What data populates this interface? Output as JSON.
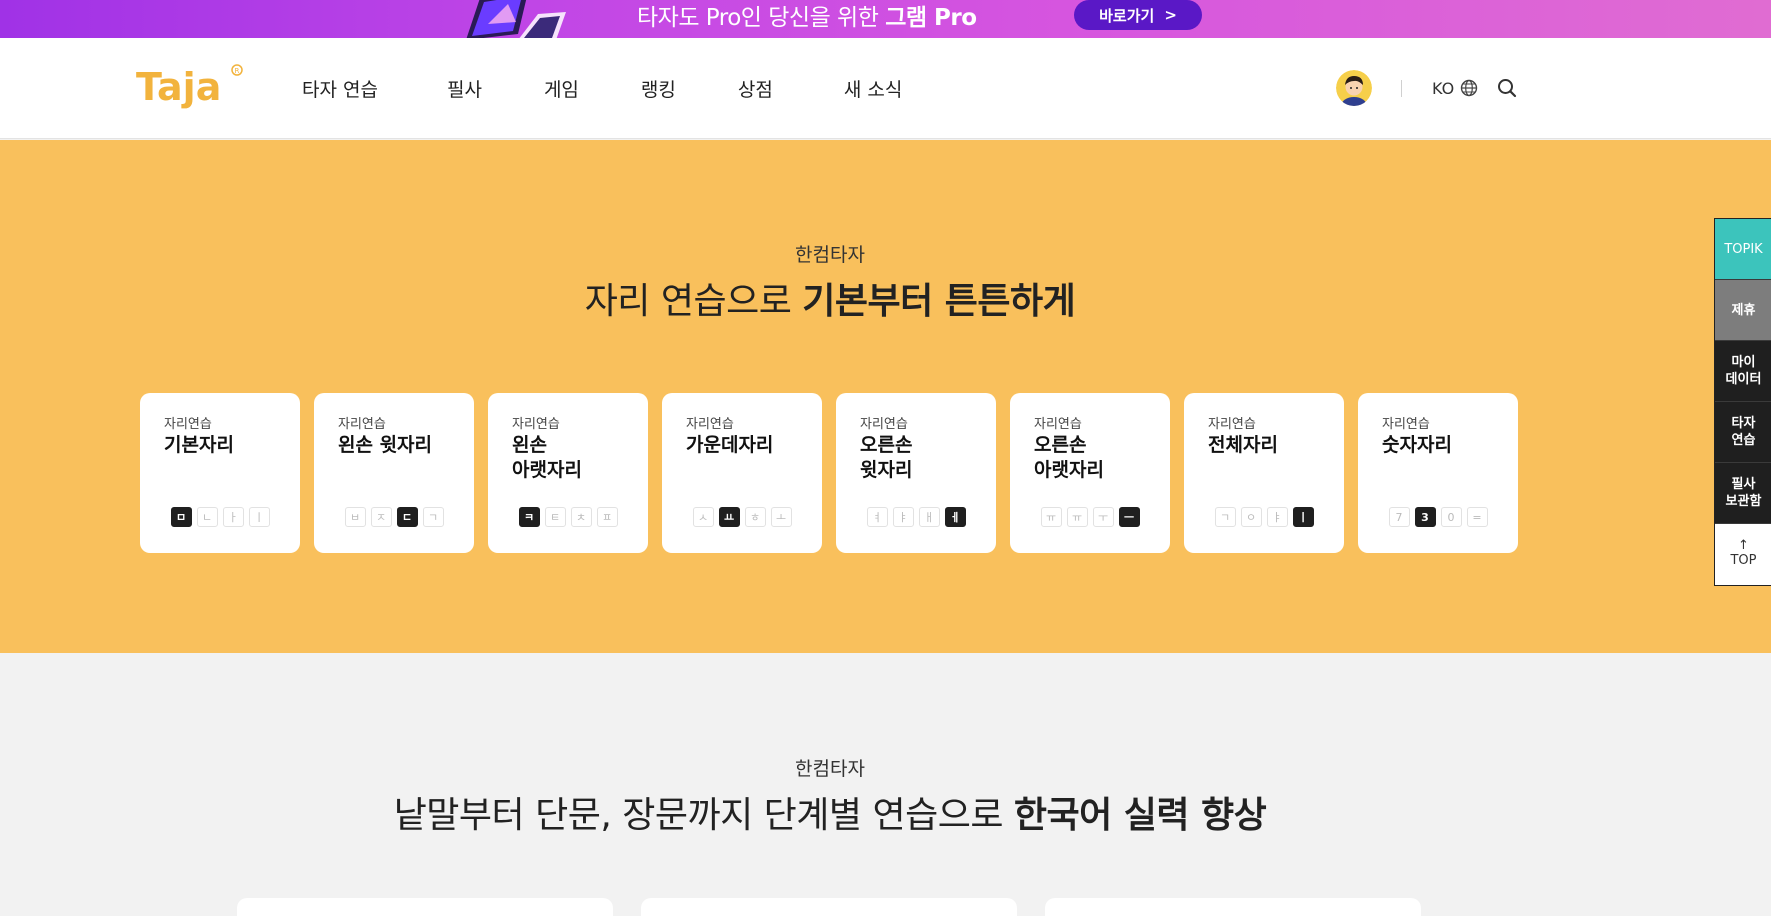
{
  "promo": {
    "text_prefix": "타자도 Pro인 당신을 위한 ",
    "text_bold": "그램 Pro",
    "button_label": "바로가기",
    "button_arrow": ">"
  },
  "header": {
    "logo_text": "Taja",
    "nav": [
      "타자 연습",
      "필사",
      "게임",
      "랭킹",
      "상점",
      "새 소식"
    ],
    "lang": "KO"
  },
  "section_position": {
    "eyebrow": "한컴타자",
    "title_regular": "자리 연습으로 ",
    "title_bold": "기본부터 튼튼하게",
    "cards": [
      {
        "eyebrow": "자리연습",
        "title": "기본자리",
        "keys": [
          "ㅁ",
          "ㄴ",
          "ㅏ",
          "ㅣ"
        ],
        "active": 0
      },
      {
        "eyebrow": "자리연습",
        "title": "왼손 윗자리",
        "keys": [
          "ㅂ",
          "ㅈ",
          "ㄷ",
          "ㄱ"
        ],
        "active": 2
      },
      {
        "eyebrow": "자리연습",
        "title": "왼손\n아랫자리",
        "keys": [
          "ㅋ",
          "ㅌ",
          "ㅊ",
          "ㅍ"
        ],
        "active": 0
      },
      {
        "eyebrow": "자리연습",
        "title": "가운데자리",
        "keys": [
          "ㅅ",
          "ㅛ",
          "ㅎ",
          "ㅗ"
        ],
        "active": 1
      },
      {
        "eyebrow": "자리연습",
        "title": "오른손\n윗자리",
        "keys": [
          "ㅕ",
          "ㅑ",
          "ㅐ",
          "ㅔ"
        ],
        "active": 3
      },
      {
        "eyebrow": "자리연습",
        "title": "오른손\n아랫자리",
        "keys": [
          "ㅠ",
          "ㅠ",
          "ㅜ",
          "ㅡ"
        ],
        "active": 3
      },
      {
        "eyebrow": "자리연습",
        "title": "전체자리",
        "keys": [
          "ㄱ",
          "ㅇ",
          "ㅑ",
          "ㅣ"
        ],
        "active": 3
      },
      {
        "eyebrow": "자리연습",
        "title": "숫자자리",
        "keys": [
          "7",
          "3",
          "0",
          "="
        ],
        "active": 1
      }
    ]
  },
  "section_korean": {
    "eyebrow": "한컴타자",
    "title_regular": "낱말부터 단문, 장문까지 단계별 연습으로 ",
    "title_bold": "한국어 실력 향상"
  },
  "side_menu": {
    "items": [
      "TOPIK",
      "제휴",
      "마이\n데이터",
      "타자\n연습",
      "필사\n보관함"
    ],
    "top_arrow": "↑",
    "top_label": "TOP"
  },
  "colors": {
    "yellow": "#f9c05c",
    "topik": "#3cc4bc",
    "promo_button": "#5a18c6",
    "logo": "#f2b33d"
  }
}
